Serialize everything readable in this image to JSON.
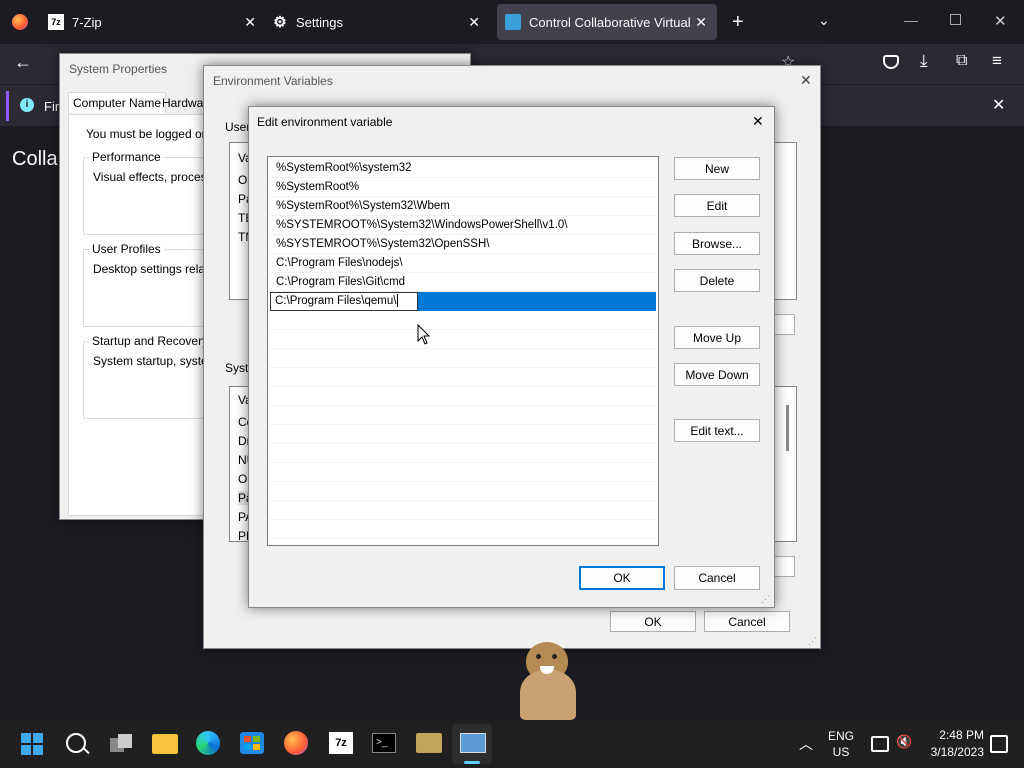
{
  "browser": {
    "tabs": [
      {
        "label": "7-Zip",
        "icon": "7zip-icon"
      },
      {
        "label": "Settings",
        "icon": "gear-icon"
      },
      {
        "label": "Control Collaborative Virtual M",
        "icon": "monitor-icon"
      }
    ],
    "infobar_text": "Fire",
    "page_heading": "Colla"
  },
  "system_properties": {
    "title": "System Properties",
    "tabs": [
      "Computer Name",
      "Hardware"
    ],
    "notice": "You must be logged on as",
    "groups": [
      {
        "label": "Performance",
        "text": "Visual effects, processor"
      },
      {
        "label": "User Profiles",
        "text": "Desktop settings related"
      },
      {
        "label": "Startup and Recovery",
        "text": "System startup, system f"
      }
    ]
  },
  "env_vars": {
    "title": "Environment Variables",
    "user_label": "User",
    "user_rows": [
      "Va",
      "On",
      "Pa",
      "TE",
      "TM"
    ],
    "system_label": "Syste",
    "system_rows": [
      "Va",
      "Co",
      "Dr",
      "NU",
      "OS",
      "Pa",
      "PA",
      "PF"
    ],
    "ok": "OK",
    "cancel": "Cancel"
  },
  "edit_dialog": {
    "title": "Edit environment variable",
    "entries": [
      "%SystemRoot%\\system32",
      "%SystemRoot%",
      "%SystemRoot%\\System32\\Wbem",
      "%SYSTEMROOT%\\System32\\WindowsPowerShell\\v1.0\\",
      "%SYSTEMROOT%\\System32\\OpenSSH\\",
      "C:\\Program Files\\nodejs\\",
      "C:\\Program Files\\Git\\cmd"
    ],
    "editing_value": "C:\\Program Files\\qemu\\",
    "buttons": {
      "new": "New",
      "edit": "Edit",
      "browse": "Browse...",
      "delete": "Delete",
      "move_up": "Move Up",
      "move_down": "Move Down",
      "edit_text": "Edit text...",
      "ok": "OK",
      "cancel": "Cancel"
    }
  },
  "taskbar": {
    "lang_line1": "ENG",
    "lang_line2": "US",
    "time": "2:48 PM",
    "date": "3/18/2023"
  },
  "colors": {
    "accent": "#0078d7",
    "tab_active": "#42414d"
  }
}
